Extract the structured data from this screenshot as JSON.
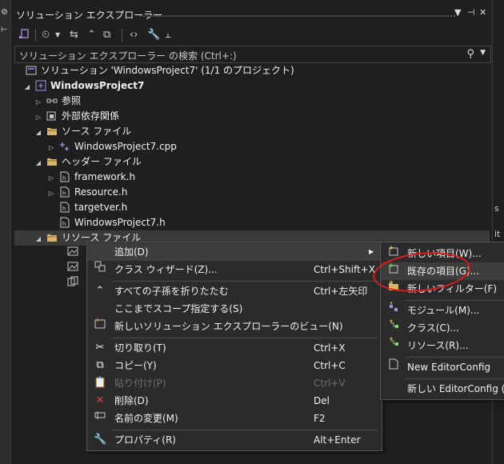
{
  "window": {
    "title": "ソリューション エクスプローラー",
    "controls": [
      "▼",
      "⊣",
      "✕"
    ]
  },
  "search": {
    "placeholder": "ソリューション エクスプローラー の検索 (Ctrl+:)"
  },
  "tree": [
    {
      "label": "ソリューション 'WindowsProject7' (1/1 のプロジェクト)",
      "icon": "solution-icon"
    },
    {
      "label": "WindowsProject7",
      "icon": "project-icon",
      "bold": true
    },
    {
      "label": "参照",
      "icon": "references-icon"
    },
    {
      "label": "外部依存関係",
      "icon": "external-dependencies-icon"
    },
    {
      "label": "ソース ファイル",
      "icon": "folder-icon"
    },
    {
      "label": "WindowsProject7.cpp",
      "icon": "cpp-file-icon"
    },
    {
      "label": "ヘッダー ファイル",
      "icon": "folder-icon"
    },
    {
      "label": "framework.h",
      "icon": "header-file-icon"
    },
    {
      "label": "Resource.h",
      "icon": "header-file-icon"
    },
    {
      "label": "targetver.h",
      "icon": "header-file-icon"
    },
    {
      "label": "WindowsProject7.h",
      "icon": "header-file-icon"
    },
    {
      "label": "リソース ファイル",
      "icon": "folder-icon"
    }
  ],
  "context_menu": {
    "items": [
      {
        "label": "追加(D)",
        "shortcut": ""
      },
      {
        "label": "クラス ウィザード(Z)...",
        "shortcut": "Ctrl+Shift+X"
      },
      {
        "label": "すべての子孫を折りたたむ",
        "shortcut": "Ctrl+左矢印"
      },
      {
        "label": "ここまでスコープ指定する(S)",
        "shortcut": ""
      },
      {
        "label": "新しいソリューション エクスプローラーのビュー(N)",
        "shortcut": ""
      },
      {
        "label": "切り取り(T)",
        "shortcut": "Ctrl+X"
      },
      {
        "label": "コピー(Y)",
        "shortcut": "Ctrl+C"
      },
      {
        "label": "貼り付け(P)",
        "shortcut": "Ctrl+V"
      },
      {
        "label": "削除(D)",
        "shortcut": "Del"
      },
      {
        "label": "名前の変更(M)",
        "shortcut": "F2"
      },
      {
        "label": "プロパティ(R)",
        "shortcut": "Alt+Enter"
      }
    ]
  },
  "submenu": {
    "items": [
      {
        "label": "新しい項目(W)..."
      },
      {
        "label": "既存の項目(G)..."
      },
      {
        "label": "新しいフィルター(F)"
      },
      {
        "label": "モジュール(M)..."
      },
      {
        "label": "クラス(C)..."
      },
      {
        "label": "リソース(R)..."
      },
      {
        "label": "New EditorConfig"
      },
      {
        "label": "新しい EditorConfig (Inte"
      }
    ]
  },
  "colors": {
    "background": "#1f1f1f",
    "menu_background": "#2b2b2b",
    "highlight": "#3d3d3d",
    "annotation": "#e01b1b",
    "accent": "#8a6fd6"
  }
}
